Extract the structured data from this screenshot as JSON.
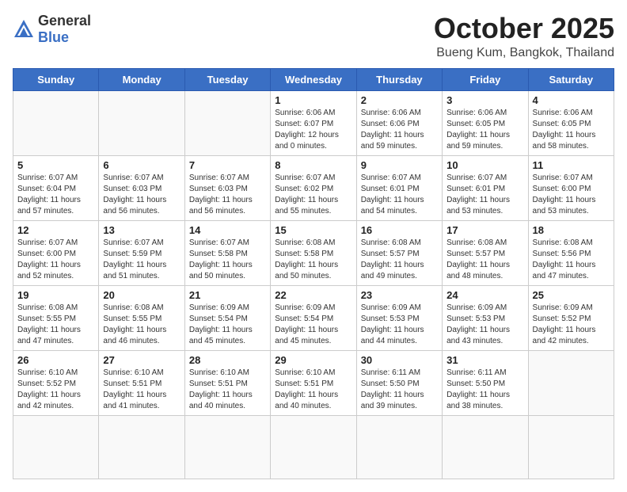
{
  "header": {
    "logo_general": "General",
    "logo_blue": "Blue",
    "month": "October 2025",
    "location": "Bueng Kum, Bangkok, Thailand"
  },
  "weekdays": [
    "Sunday",
    "Monday",
    "Tuesday",
    "Wednesday",
    "Thursday",
    "Friday",
    "Saturday"
  ],
  "days": [
    {
      "date": null,
      "info": null
    },
    {
      "date": null,
      "info": null
    },
    {
      "date": null,
      "info": null
    },
    {
      "date": "1",
      "info": "Sunrise: 6:06 AM\nSunset: 6:07 PM\nDaylight: 12 hours\nand 0 minutes."
    },
    {
      "date": "2",
      "info": "Sunrise: 6:06 AM\nSunset: 6:06 PM\nDaylight: 11 hours\nand 59 minutes."
    },
    {
      "date": "3",
      "info": "Sunrise: 6:06 AM\nSunset: 6:05 PM\nDaylight: 11 hours\nand 59 minutes."
    },
    {
      "date": "4",
      "info": "Sunrise: 6:06 AM\nSunset: 6:05 PM\nDaylight: 11 hours\nand 58 minutes."
    },
    {
      "date": "5",
      "info": "Sunrise: 6:07 AM\nSunset: 6:04 PM\nDaylight: 11 hours\nand 57 minutes."
    },
    {
      "date": "6",
      "info": "Sunrise: 6:07 AM\nSunset: 6:03 PM\nDaylight: 11 hours\nand 56 minutes."
    },
    {
      "date": "7",
      "info": "Sunrise: 6:07 AM\nSunset: 6:03 PM\nDaylight: 11 hours\nand 56 minutes."
    },
    {
      "date": "8",
      "info": "Sunrise: 6:07 AM\nSunset: 6:02 PM\nDaylight: 11 hours\nand 55 minutes."
    },
    {
      "date": "9",
      "info": "Sunrise: 6:07 AM\nSunset: 6:01 PM\nDaylight: 11 hours\nand 54 minutes."
    },
    {
      "date": "10",
      "info": "Sunrise: 6:07 AM\nSunset: 6:01 PM\nDaylight: 11 hours\nand 53 minutes."
    },
    {
      "date": "11",
      "info": "Sunrise: 6:07 AM\nSunset: 6:00 PM\nDaylight: 11 hours\nand 53 minutes."
    },
    {
      "date": "12",
      "info": "Sunrise: 6:07 AM\nSunset: 6:00 PM\nDaylight: 11 hours\nand 52 minutes."
    },
    {
      "date": "13",
      "info": "Sunrise: 6:07 AM\nSunset: 5:59 PM\nDaylight: 11 hours\nand 51 minutes."
    },
    {
      "date": "14",
      "info": "Sunrise: 6:07 AM\nSunset: 5:58 PM\nDaylight: 11 hours\nand 50 minutes."
    },
    {
      "date": "15",
      "info": "Sunrise: 6:08 AM\nSunset: 5:58 PM\nDaylight: 11 hours\nand 50 minutes."
    },
    {
      "date": "16",
      "info": "Sunrise: 6:08 AM\nSunset: 5:57 PM\nDaylight: 11 hours\nand 49 minutes."
    },
    {
      "date": "17",
      "info": "Sunrise: 6:08 AM\nSunset: 5:57 PM\nDaylight: 11 hours\nand 48 minutes."
    },
    {
      "date": "18",
      "info": "Sunrise: 6:08 AM\nSunset: 5:56 PM\nDaylight: 11 hours\nand 47 minutes."
    },
    {
      "date": "19",
      "info": "Sunrise: 6:08 AM\nSunset: 5:55 PM\nDaylight: 11 hours\nand 47 minutes."
    },
    {
      "date": "20",
      "info": "Sunrise: 6:08 AM\nSunset: 5:55 PM\nDaylight: 11 hours\nand 46 minutes."
    },
    {
      "date": "21",
      "info": "Sunrise: 6:09 AM\nSunset: 5:54 PM\nDaylight: 11 hours\nand 45 minutes."
    },
    {
      "date": "22",
      "info": "Sunrise: 6:09 AM\nSunset: 5:54 PM\nDaylight: 11 hours\nand 45 minutes."
    },
    {
      "date": "23",
      "info": "Sunrise: 6:09 AM\nSunset: 5:53 PM\nDaylight: 11 hours\nand 44 minutes."
    },
    {
      "date": "24",
      "info": "Sunrise: 6:09 AM\nSunset: 5:53 PM\nDaylight: 11 hours\nand 43 minutes."
    },
    {
      "date": "25",
      "info": "Sunrise: 6:09 AM\nSunset: 5:52 PM\nDaylight: 11 hours\nand 42 minutes."
    },
    {
      "date": "26",
      "info": "Sunrise: 6:10 AM\nSunset: 5:52 PM\nDaylight: 11 hours\nand 42 minutes."
    },
    {
      "date": "27",
      "info": "Sunrise: 6:10 AM\nSunset: 5:51 PM\nDaylight: 11 hours\nand 41 minutes."
    },
    {
      "date": "28",
      "info": "Sunrise: 6:10 AM\nSunset: 5:51 PM\nDaylight: 11 hours\nand 40 minutes."
    },
    {
      "date": "29",
      "info": "Sunrise: 6:10 AM\nSunset: 5:51 PM\nDaylight: 11 hours\nand 40 minutes."
    },
    {
      "date": "30",
      "info": "Sunrise: 6:11 AM\nSunset: 5:50 PM\nDaylight: 11 hours\nand 39 minutes."
    },
    {
      "date": "31",
      "info": "Sunrise: 6:11 AM\nSunset: 5:50 PM\nDaylight: 11 hours\nand 38 minutes."
    },
    {
      "date": null,
      "info": null
    },
    {
      "date": null,
      "info": null
    },
    {
      "date": null,
      "info": null
    },
    {
      "date": null,
      "info": null
    },
    {
      "date": null,
      "info": null
    }
  ]
}
